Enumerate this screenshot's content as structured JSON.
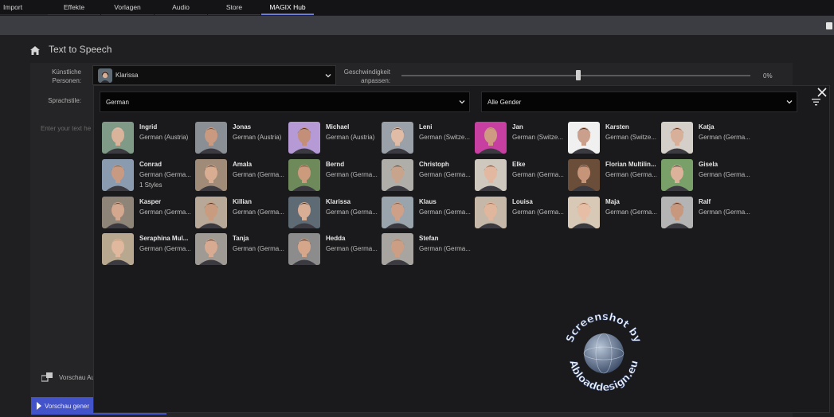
{
  "menu": {
    "tabs": [
      {
        "label": "Import"
      },
      {
        "label": "Effekte"
      },
      {
        "label": "Vorlagen"
      },
      {
        "label": "Audio"
      },
      {
        "label": "Store"
      },
      {
        "label": "MAGIX Hub"
      }
    ],
    "active_index": 5
  },
  "page": {
    "title": "Text to Speech"
  },
  "form": {
    "persona_label": "Künstliche Personen:",
    "persona_value": "Klarissa",
    "speed_label": "Geschwindigkeit anpassen:",
    "speed_value": "0%",
    "speed_fraction": 0.5,
    "styles_label": "Sprachstile:",
    "text_placeholder": "Enter your text he",
    "preview_auto_label": "Vorschau Au",
    "generate_button": "Vorschau gener",
    "progress_fraction": 0.25
  },
  "picker": {
    "language_value": "German",
    "gender_value": "Alle Gender",
    "voices": [
      {
        "name": "Ingrid",
        "lang": "German (Austria)",
        "extra": ""
      },
      {
        "name": "Jonas",
        "lang": "German (Austria)",
        "extra": ""
      },
      {
        "name": "Michael",
        "lang": "German (Austria)",
        "extra": ""
      },
      {
        "name": "Leni",
        "lang": "German (Switze...",
        "extra": ""
      },
      {
        "name": "Jan",
        "lang": "German (Switze...",
        "extra": ""
      },
      {
        "name": "Karsten",
        "lang": "German (Switze...",
        "extra": ""
      },
      {
        "name": "Katja",
        "lang": "German (Germa...",
        "extra": ""
      },
      {
        "name": "Conrad",
        "lang": "German (Germa...",
        "extra": "1 Styles"
      },
      {
        "name": "Amala",
        "lang": "German (Germa...",
        "extra": ""
      },
      {
        "name": "Bernd",
        "lang": "German (Germa...",
        "extra": ""
      },
      {
        "name": "Christoph",
        "lang": "German (Germa...",
        "extra": ""
      },
      {
        "name": "Elke",
        "lang": "German (Germa...",
        "extra": ""
      },
      {
        "name": "Florian Multilin...",
        "lang": "German (Germa...",
        "extra": ""
      },
      {
        "name": "Gisela",
        "lang": "German (Germa...",
        "extra": ""
      },
      {
        "name": "Kasper",
        "lang": "German (Germa...",
        "extra": ""
      },
      {
        "name": "Killian",
        "lang": "German (Germa...",
        "extra": ""
      },
      {
        "name": "Klarissa",
        "lang": "German (Germa...",
        "extra": ""
      },
      {
        "name": "Klaus",
        "lang": "German (Germa...",
        "extra": ""
      },
      {
        "name": "Louisa",
        "lang": "German (Germa...",
        "extra": ""
      },
      {
        "name": "Maja",
        "lang": "German (Germa...",
        "extra": ""
      },
      {
        "name": "Ralf",
        "lang": "German (Germa...",
        "extra": ""
      },
      {
        "name": "Seraphina Mul...",
        "lang": "German (Germa...",
        "extra": ""
      },
      {
        "name": "Tanja",
        "lang": "German (Germa...",
        "extra": ""
      },
      {
        "name": "Hedda",
        "lang": "German (Germa...",
        "extra": ""
      },
      {
        "name": "Stefan",
        "lang": "German (Germa...",
        "extra": ""
      }
    ]
  },
  "watermark": {
    "line1": "Screenshot by",
    "line2": "Abloaddesign.eu"
  },
  "colors": {
    "accent": "#4353c9",
    "active_tab": "#6b7bd8"
  }
}
